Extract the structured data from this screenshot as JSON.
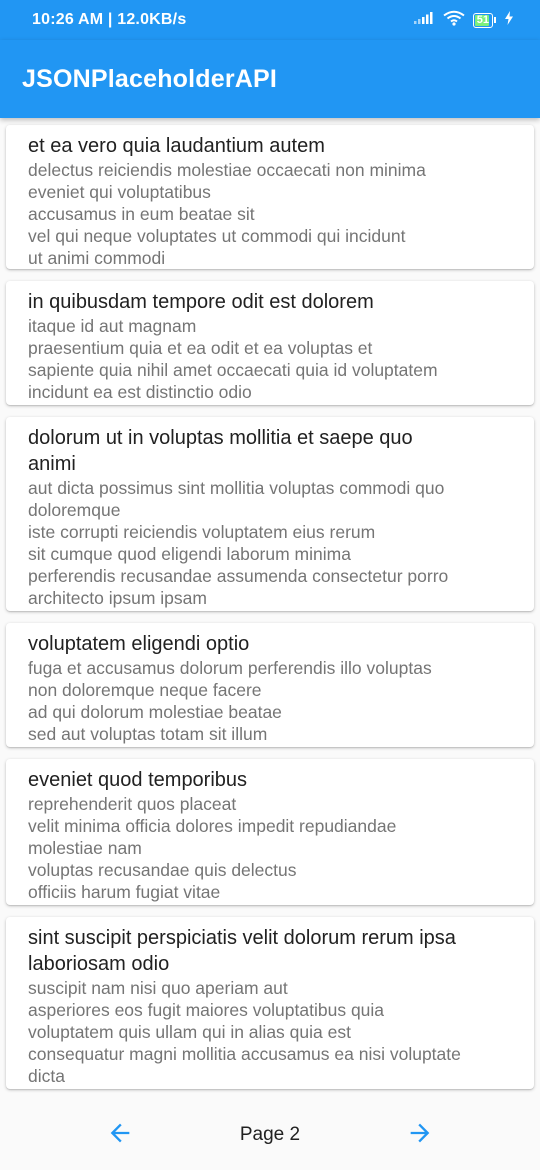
{
  "status_bar": {
    "time": "10:26 AM | 12.0KB/s",
    "battery": "51",
    "icons": [
      "signal-icon",
      "wifi-icon",
      "battery-icon",
      "charging-icon"
    ]
  },
  "app_bar": {
    "title": "JSONPlaceholderAPI"
  },
  "posts": [
    {
      "title": "et ea vero quia laudantium autem",
      "body": "delectus reiciendis molestiae occaecati non minima\neveniet qui voluptatibus\naccusamus in eum beatae sit\nvel qui neque voluptates ut commodi qui incidunt\nut animi commodi"
    },
    {
      "title": "in quibusdam tempore odit est dolorem",
      "body": "itaque id aut magnam\npraesentium quia et ea odit et ea voluptas et\nsapiente quia nihil amet occaecati quia id voluptatem\nincidunt ea est distinctio odio"
    },
    {
      "title": "dolorum ut in voluptas mollitia et saepe quo\nanimi",
      "body": "aut dicta possimus sint mollitia voluptas commodi quo\ndoloremque\niste corrupti reiciendis voluptatem eius rerum\nsit cumque quod eligendi laborum minima\nperferendis recusandae assumenda consectetur porro\narchitecto ipsum ipsam"
    },
    {
      "title": "voluptatem eligendi optio",
      "body": "fuga et accusamus dolorum perferendis illo voluptas\nnon doloremque neque facere\nad qui dolorum molestiae beatae\nsed aut voluptas totam sit illum"
    },
    {
      "title": "eveniet quod temporibus",
      "body": "reprehenderit quos placeat\nvelit minima officia dolores impedit repudiandae\nmolestiae nam\nvoluptas recusandae quis delectus\nofficiis harum fugiat vitae"
    },
    {
      "title": "sint suscipit perspiciatis velit dolorum rerum ipsa\nlaboriosam odio",
      "body": "suscipit nam nisi quo aperiam aut\nasperiores eos fugit maiores voluptatibus quia\nvoluptatem quis ullam qui in alias quia est\nconsequatur magni mollitia accusamus ea nisi voluptate\ndicta"
    }
  ],
  "pager": {
    "label": "Page 2",
    "prev_icon": "arrow-left-icon",
    "next_icon": "arrow-right-icon",
    "accent_color": "#2196f3"
  },
  "colors": {
    "primary": "#2196f3",
    "title_text": "#212121",
    "body_text": "#757575"
  }
}
